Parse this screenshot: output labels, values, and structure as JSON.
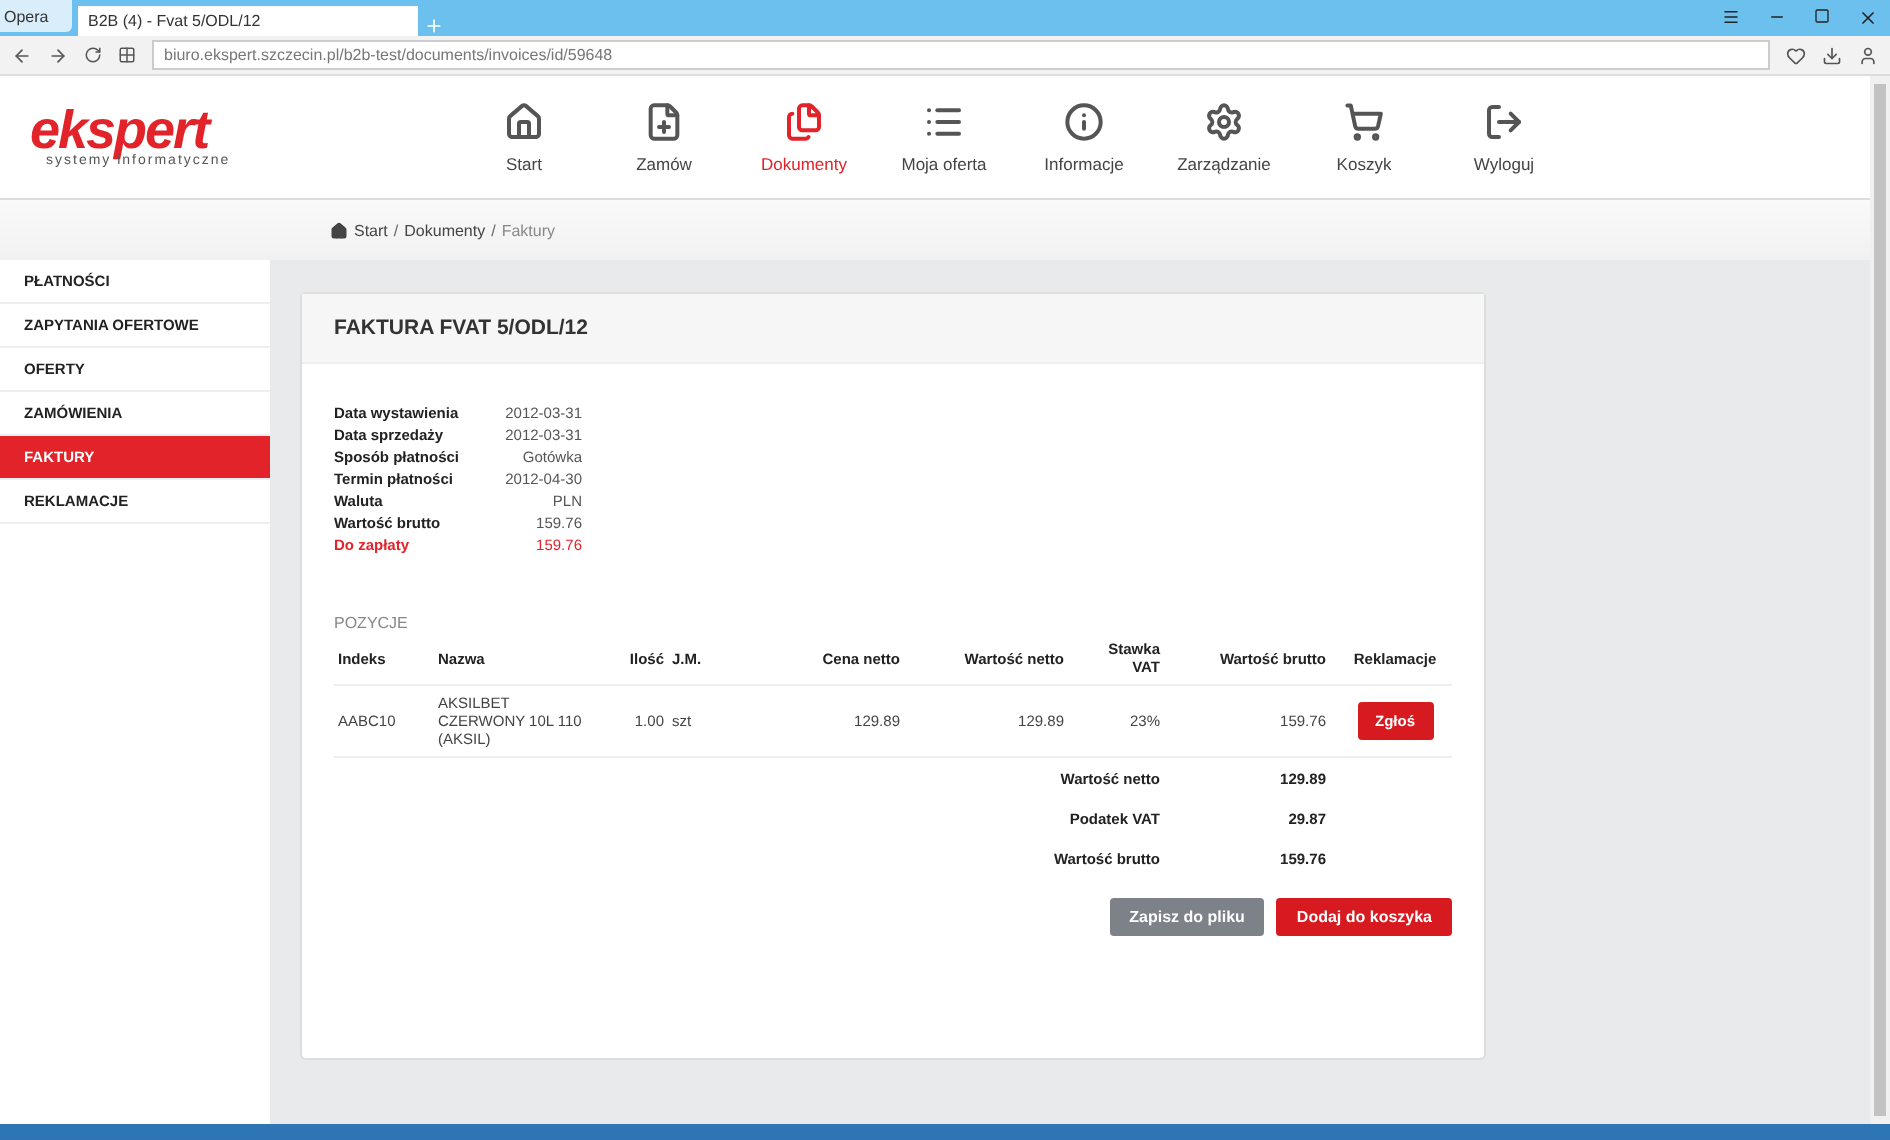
{
  "browser": {
    "menu_label": "Opera",
    "tab_title": "B2B (4) - Fvat 5/ODL/12",
    "url": "biuro.ekspert.szczecin.pl/b2b-test/documents/invoices/id/59648"
  },
  "logo": {
    "name": "ekspert",
    "tagline": "systemy informatyczne"
  },
  "nav": [
    {
      "label": "Start",
      "kind": "home",
      "selected": false
    },
    {
      "label": "Zamów",
      "kind": "order",
      "selected": false
    },
    {
      "label": "Dokumenty",
      "kind": "documents",
      "selected": true
    },
    {
      "label": "Moja oferta",
      "kind": "list",
      "selected": false
    },
    {
      "label": "Informacje",
      "kind": "info",
      "selected": false
    },
    {
      "label": "Zarządzanie",
      "kind": "settings",
      "selected": false
    },
    {
      "label": "Koszyk",
      "kind": "cart",
      "selected": false
    },
    {
      "label": "Wyloguj",
      "kind": "logout",
      "selected": false
    }
  ],
  "breadcrumb": {
    "separator": "/",
    "items": [
      "Start",
      "Dokumenty",
      "Faktury"
    ]
  },
  "sidebar": {
    "items": [
      {
        "label": "PŁATNOŚCI",
        "selected": false
      },
      {
        "label": "ZAPYTANIA OFERTOWE",
        "selected": false
      },
      {
        "label": "OFERTY",
        "selected": false
      },
      {
        "label": "ZAMÓWIENIA",
        "selected": false
      },
      {
        "label": "FAKTURY",
        "selected": true
      },
      {
        "label": "REKLAMACJE",
        "selected": false
      }
    ]
  },
  "invoice": {
    "title": "FAKTURA FVAT 5/ODL/12",
    "details": [
      {
        "label": "Data wystawienia",
        "value": "2012-03-31",
        "kind": "normal"
      },
      {
        "label": "Data sprzedaży",
        "value": "2012-03-31",
        "kind": "normal"
      },
      {
        "label": "Sposób płatności",
        "value": "Gotówka",
        "kind": "normal"
      },
      {
        "label": "Termin płatności",
        "value": "2012-04-30",
        "kind": "normal"
      },
      {
        "label": "Waluta",
        "value": "PLN",
        "kind": "normal"
      },
      {
        "label": "Wartość brutto",
        "value": "159.76",
        "kind": "normal"
      },
      {
        "label": "Do zapłaty",
        "value": "159.76",
        "kind": "due"
      }
    ],
    "section_label": "POZYCJE",
    "columns": [
      "Indeks",
      "Nazwa",
      "Ilość",
      "J.M.",
      "Cena netto",
      "Wartość netto",
      "Stawka VAT",
      "Wartość brutto",
      "Reklamacje"
    ],
    "rows": [
      {
        "cells": [
          "AABC10",
          "AKSILBET CZERWONY 10L 110 (AKSIL)",
          "1.00",
          "szt",
          "129.89",
          "129.89",
          "23%",
          "159.76"
        ],
        "action": "Zgłoś"
      }
    ],
    "totals": [
      {
        "label": "Wartość netto",
        "value": "129.89"
      },
      {
        "label": "Podatek VAT",
        "value": "29.87"
      },
      {
        "label": "Wartość brutto",
        "value": "159.76"
      }
    ],
    "buttons": [
      {
        "label": "Zapisz do pliku",
        "kind": "secondary"
      },
      {
        "label": "Dodaj do koszyka",
        "kind": "primary"
      }
    ]
  }
}
